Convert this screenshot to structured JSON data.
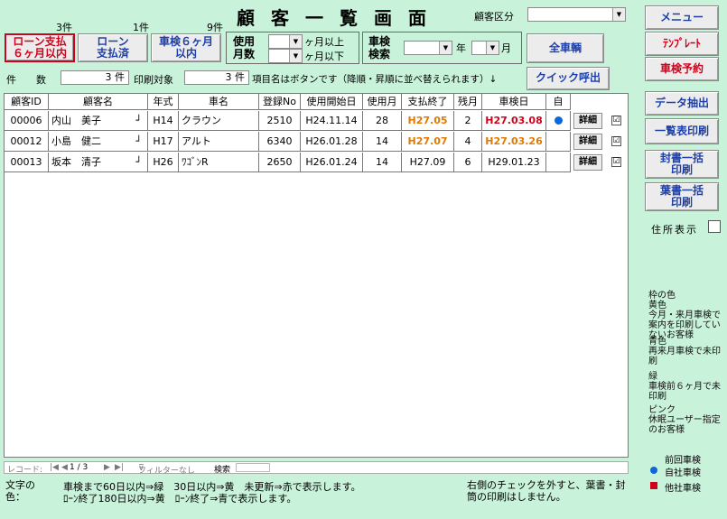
{
  "header": {
    "title": "顧客一覧画面",
    "count_loan_6": "3件",
    "count_loan_done": "1件",
    "count_inspect_6": "9件"
  },
  "top_buttons": {
    "loan_6": "ローン支払\n６ヶ月以内",
    "loan_done": "ローン\n支払済",
    "inspect_6": "車検６ヶ月\n以内",
    "all_cars": "全車輌",
    "quick_call": "クイック呼出"
  },
  "filters": {
    "usage_label": "使用\n月数",
    "usage_over": "ヶ月以上",
    "usage_under": "ヶ月以下",
    "inspect_label": "車検\n検索",
    "year_label": "年",
    "month_label": "月",
    "customer_type_label": "顧客区分",
    "count_label": "件　　数",
    "count_value": "3 件",
    "print_target_label": "印刷対象",
    "print_target_value": "3 件",
    "sort_hint": "項目名はボタンです（降順・昇順に並べ替えられます）↓"
  },
  "columns": [
    "顧客ID",
    "顧客名",
    "年式",
    "車名",
    "登録No",
    "使用開始日",
    "使用月",
    "支払終了",
    "残月",
    "車検日",
    "自"
  ],
  "rows": [
    {
      "id": "00006",
      "name": "内山　美子",
      "year": "H14",
      "car": "クラウン",
      "reg": "2510",
      "start": "H24.11.14",
      "months": "28",
      "pay_end": "H27.05",
      "remain": "2",
      "inspect": "H27.03.08",
      "detail": "詳細",
      "checked": "☑"
    },
    {
      "id": "00012",
      "name": "小島　健二",
      "year": "H17",
      "car": "アルト",
      "reg": "6340",
      "start": "H26.01.28",
      "months": "14",
      "pay_end": "H27.07",
      "remain": "4",
      "inspect": "H27.03.26",
      "detail": "詳細",
      "checked": "☑"
    },
    {
      "id": "00013",
      "name": "坂本　清子",
      "year": "H26",
      "car": "ﾜｺﾞﾝR",
      "reg": "2650",
      "start": "H26.01.24",
      "months": "14",
      "pay_end": "H27.09",
      "remain": "6",
      "inspect": "H29.01.23",
      "detail": "詳細",
      "checked": "☑"
    }
  ],
  "navbar": {
    "record_label": "レコード:",
    "record_pos": "1 / 3",
    "filter": "フィルターなし",
    "search": "検索"
  },
  "sidebar": {
    "menu": "メニュー",
    "template": "ﾃﾝﾌﾟﾚｰﾄ",
    "inspect_reserve": "車検予約",
    "data_extract": "データ抽出",
    "list_print": "一覧表印刷",
    "envelope_print": "封書一括\n印刷",
    "postcard_print": "葉書一括\n印刷",
    "address_show": "住所表示"
  },
  "legend": {
    "frame_color": "枠の色\n黄色\n今月・来月車検で案内を印刷していないお客様",
    "blue": "青色\n再来月車検で未印刷",
    "green": "緑\n車検前６ヶ月で未印刷",
    "pink": "ピンク\n休眠ユーザー指定のお客様",
    "prev_inspect": "前回車検",
    "own": "自社車検",
    "other": "他社車検",
    "own_color": "#0a68d8",
    "other_color": "#d0021b"
  },
  "footer": {
    "text_color_label": "文字の\n色：",
    "line1": "車検まで60日以内⇒緑　30日以内⇒黄　未更新⇒赤で表示します。",
    "line2": "ﾛｰﾝ終了180日以内⇒黄　ﾛｰﾝ終了⇒青で表示します。",
    "right_note": "右側のチェックを外すと、葉書・封筒の印刷はしません。"
  }
}
